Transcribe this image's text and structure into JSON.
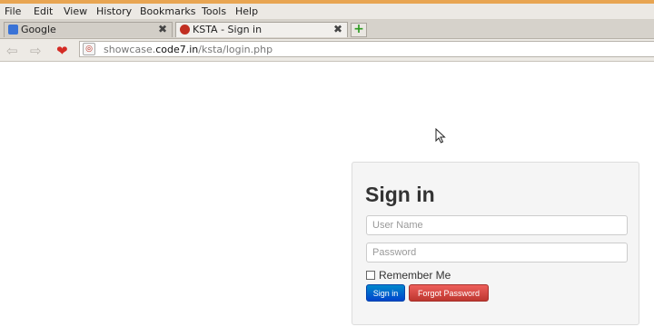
{
  "browser": {
    "menu": [
      "File",
      "Edit",
      "View",
      "History",
      "Bookmarks",
      "Tools",
      "Help"
    ],
    "tabs": [
      {
        "title": "Google",
        "close": "✖",
        "favicon_color": "#3a73d6"
      },
      {
        "title": "KSTA - Sign in",
        "close": "✖",
        "favicon_color": "#c12f22"
      }
    ],
    "new_tab_icon": "+",
    "nav": {
      "back": "⇦",
      "forward": "⇨",
      "bookmark": "❤"
    },
    "url": {
      "prefix": "showcase.",
      "domain": "code7.in",
      "path": "/ksta/login.php"
    },
    "accent_color": "#e8a552"
  },
  "login": {
    "title": "Sign in",
    "username_placeholder": "User Name",
    "password_placeholder": "Password",
    "remember_label": "Remember Me",
    "signin_button": "Sign in",
    "forgot_button": "Forgot Password",
    "signin_color": "#0055cc",
    "forgot_color": "#da4f49"
  }
}
